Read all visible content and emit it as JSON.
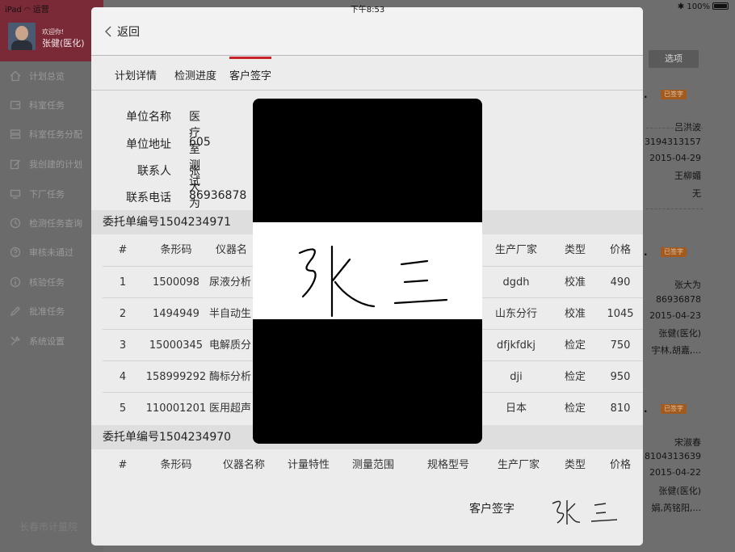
{
  "status_bar": {
    "device": "iPad",
    "carrier": "运营",
    "time": "下午8:53",
    "battery": "100%"
  },
  "sidebar": {
    "welcome": "欢迎你!",
    "user_name": "张健(医化)",
    "items": [
      {
        "label": "计划总览",
        "icon": "home-icon"
      },
      {
        "label": "科室任务",
        "icon": "wallet-icon"
      },
      {
        "label": "科室任务分配",
        "icon": "tray-icon"
      },
      {
        "label": "我创建的计划",
        "icon": "edit-icon"
      },
      {
        "label": "下厂任务",
        "icon": "truck-icon"
      },
      {
        "label": "检测任务查询",
        "icon": "clock-icon"
      },
      {
        "label": "审核未通过",
        "icon": "help-icon"
      },
      {
        "label": "核验任务",
        "icon": "info-icon"
      },
      {
        "label": "批准任务",
        "icon": "pencil-icon"
      },
      {
        "label": "系统设置",
        "icon": "tools-icon"
      }
    ],
    "footer": "长春市计量院"
  },
  "background_list": {
    "select_label": "选项",
    "badge": "已签字",
    "groups": [
      {
        "lines": [
          "吕洪波",
          "3194313157",
          "2015-04-29",
          "王柳媚",
          "无"
        ]
      },
      {
        "lines": [
          "张大为",
          "86936878",
          "2015-04-23",
          "张健(医化)",
          "宇林,胡嘉,..."
        ]
      },
      {
        "lines": [
          "宋淑春",
          "8104313639",
          "2015-04-22",
          "张健(医化)",
          "娟,芮铭阳,..."
        ]
      }
    ]
  },
  "modal": {
    "back_label": "返回",
    "tabs": [
      {
        "label": "计划详情"
      },
      {
        "label": "检测进度"
      },
      {
        "label": "客户签字",
        "active": true
      }
    ],
    "info": [
      {
        "label": "单位名称",
        "value": "医疗室测试"
      },
      {
        "label": "单位地址",
        "value": "605"
      },
      {
        "label": "联系人",
        "value": "张大为"
      },
      {
        "label": "联系电话",
        "value": "86936878"
      }
    ],
    "order1": {
      "title": "委托单编号1504234971",
      "headers": {
        "idx": "#",
        "code": "条形码",
        "name": "仪器名",
        "mfr": "生产厂家",
        "type": "类型",
        "price": "价格"
      },
      "rows": [
        {
          "idx": "1",
          "code": "1500098",
          "name": "尿液分析",
          "mfr": "dgdh",
          "type": "校准",
          "price": "490"
        },
        {
          "idx": "2",
          "code": "1494949",
          "name": "半自动生",
          "mfr": "山东分行",
          "type": "校准",
          "price": "1045"
        },
        {
          "idx": "3",
          "code": "15000345",
          "name": "电解质分",
          "mfr": "dfjkfdkj",
          "type": "检定",
          "price": "750"
        },
        {
          "idx": "4",
          "code": "158999292",
          "name": "酶标分析",
          "mfr": "dji",
          "type": "检定",
          "price": "950"
        },
        {
          "idx": "5",
          "code": "110001201",
          "name": "医用超声",
          "mfr": "日本",
          "type": "检定",
          "price": "810"
        }
      ]
    },
    "order2": {
      "title": "委托单编号1504234970",
      "headers": [
        "#",
        "条形码",
        "仪器名称",
        "计量特性",
        "测量范围",
        "规格型号",
        "生产厂家",
        "类型",
        "价格"
      ]
    },
    "signature_label": "客户签字"
  },
  "colors": {
    "accent": "#c8232c",
    "modal_bg": "#ececec",
    "overlay": "#6e6e6e"
  }
}
